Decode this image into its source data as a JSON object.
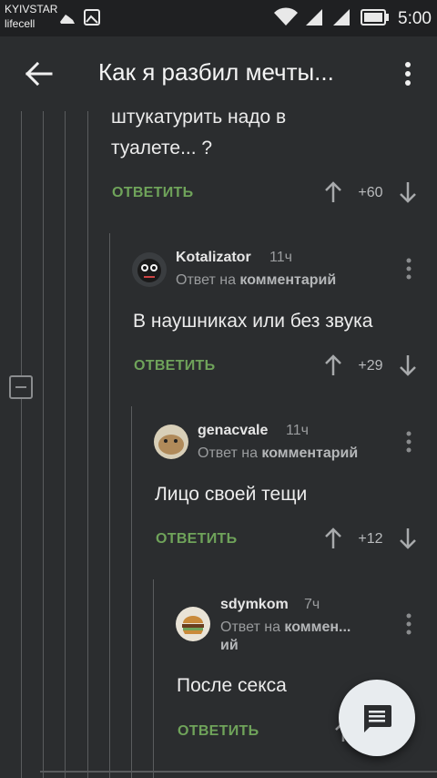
{
  "status_bar": {
    "carrier1": "KYIVSTAR",
    "carrier2": "lifecell",
    "time": "5:00"
  },
  "toolbar": {
    "title": "Как я разбил мечты..."
  },
  "comments": [
    {
      "text1": "штукатурить надо в",
      "text2": "туалете... ?",
      "reply": "ОТВЕТИТЬ",
      "score": "+60"
    },
    {
      "author": "Kotalizator",
      "time": "11ч",
      "sub_prefix": "Ответ на",
      "sub_link": "комментарий",
      "text": "В наушниках или без звука",
      "reply": "ОТВЕТИТЬ",
      "score": "+29"
    },
    {
      "author": "genacvale",
      "time": "11ч",
      "sub_prefix": "Ответ на",
      "sub_link": "комментарий",
      "text": "Лицо своей тещи",
      "reply": "ОТВЕТИТЬ",
      "score": "+12"
    },
    {
      "author": "sdymkom",
      "time": "7ч",
      "sub_prefix": "Ответ на",
      "sub_link": "коммен...",
      "sub_cont": "ий",
      "text": "После секса",
      "reply": "ОТВЕТИТЬ"
    }
  ],
  "colors": {
    "background": "#2b2d2f",
    "accent_green": "#6fa35a",
    "fab": "#e8ecef"
  },
  "icons": [
    "back-arrow-icon",
    "more-vert-icon",
    "arrow-up-icon",
    "arrow-down-icon",
    "comment-icon",
    "wifi-icon",
    "signal-icon",
    "battery-icon"
  ]
}
